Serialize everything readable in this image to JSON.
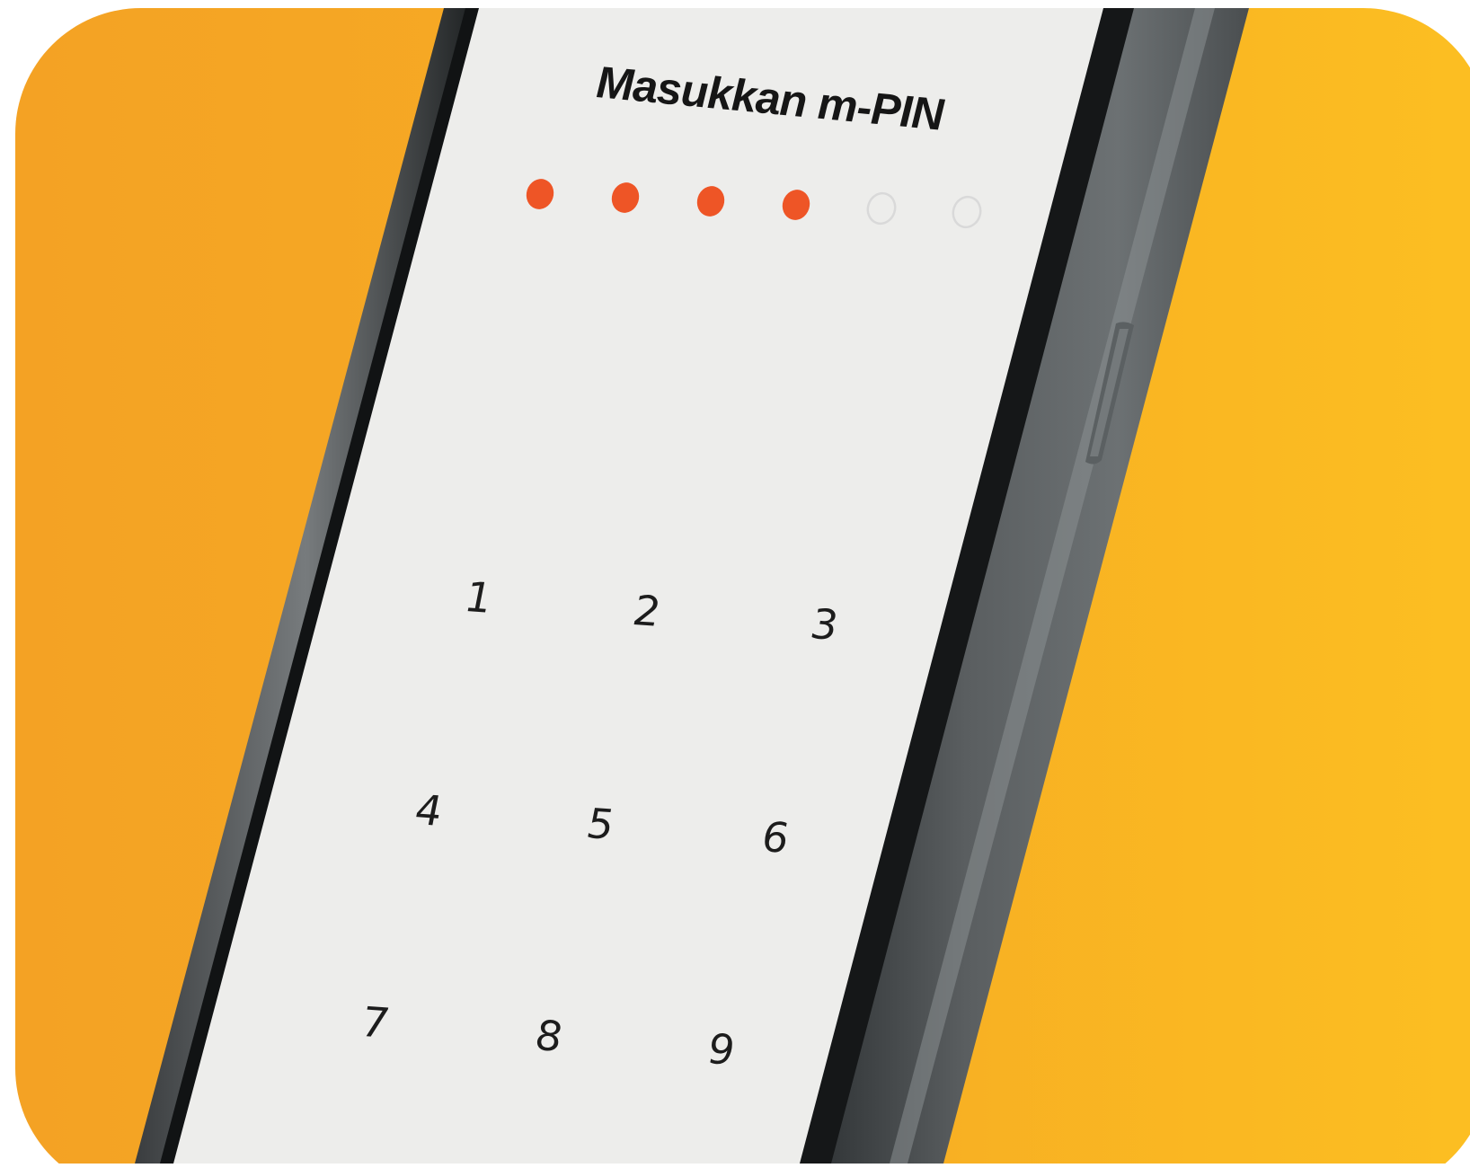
{
  "pin_screen": {
    "title": "Masukkan m-PIN",
    "pin_length": 6,
    "digits_entered": 4,
    "keypad": [
      "1",
      "2",
      "3",
      "4",
      "5",
      "6",
      "7",
      "8",
      "9"
    ]
  },
  "colors": {
    "background_left": "#F4A224",
    "background_right": "#FCBF22",
    "screen": "#EDEDEB",
    "phone_frame": "#3D4143",
    "pin_dot_filled": "#EE5526",
    "pin_dot_empty_stroke": "#D9D9D9",
    "text": "#161616"
  }
}
